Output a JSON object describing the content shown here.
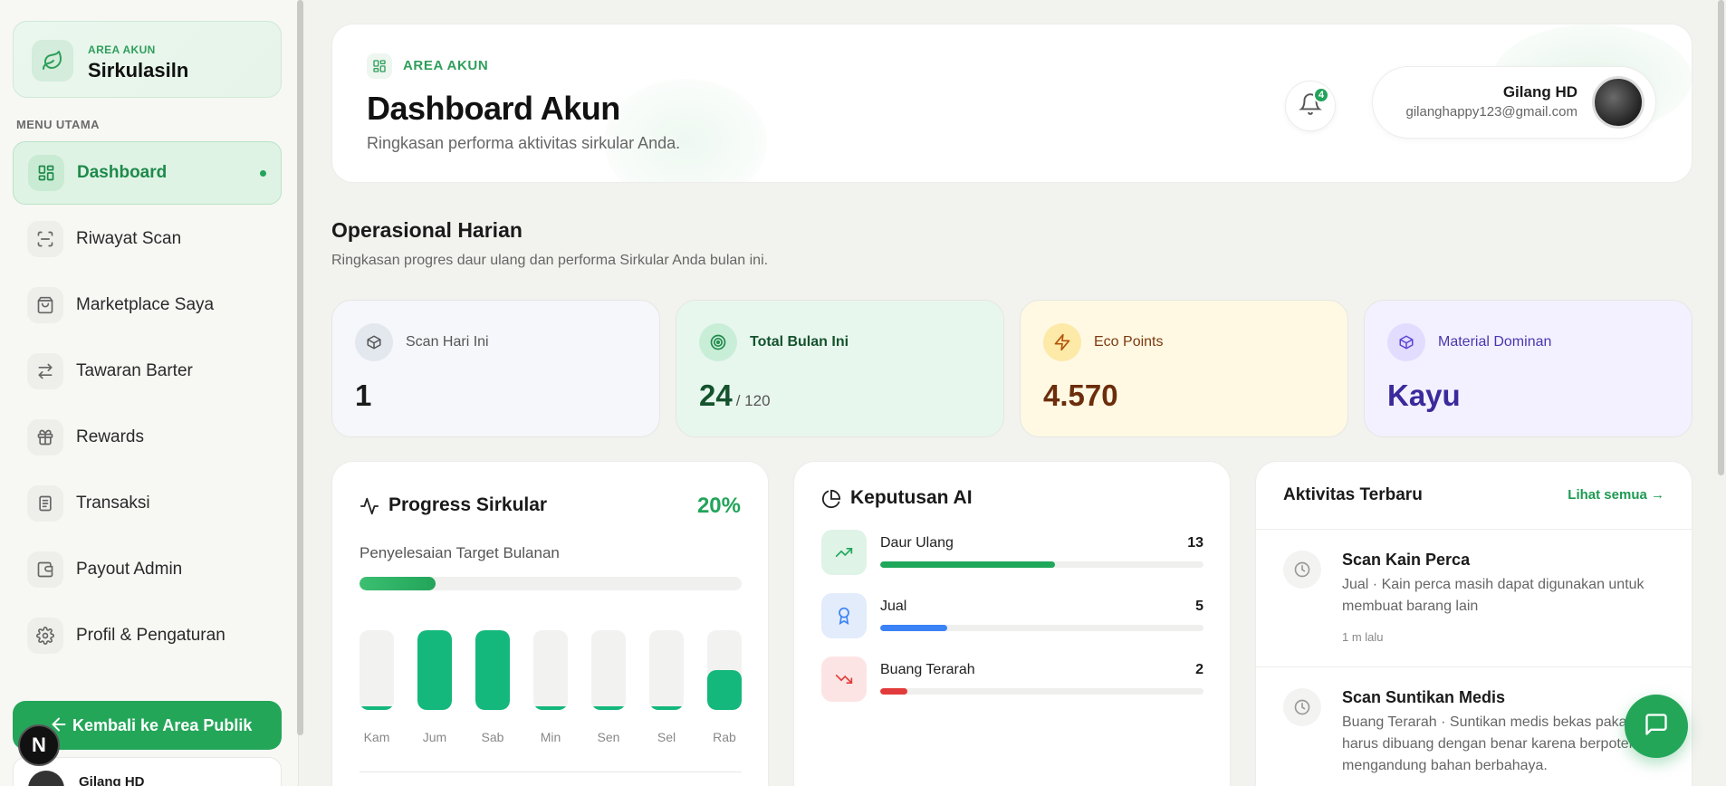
{
  "brand": {
    "small": "AREA AKUN",
    "title": "Sirkulasiln"
  },
  "sidebar": {
    "menu_title": "MENU UTAMA",
    "items": [
      {
        "label": "Dashboard",
        "icon": "dashboard-icon",
        "active": true
      },
      {
        "label": "Riwayat Scan",
        "icon": "scan-icon"
      },
      {
        "label": "Marketplace Saya",
        "icon": "shopping-bag-icon"
      },
      {
        "label": "Tawaran Barter",
        "icon": "swap-icon"
      },
      {
        "label": "Rewards",
        "icon": "gift-icon"
      },
      {
        "label": "Transaksi",
        "icon": "receipt-icon"
      },
      {
        "label": "Payout Admin",
        "icon": "wallet-icon"
      },
      {
        "label": "Profil & Pengaturan",
        "icon": "gear-icon"
      }
    ],
    "back_button": "Kembali ke Area Publik",
    "user_name": "Gilang HD",
    "n_badge": "N"
  },
  "header": {
    "small": "AREA AKUN",
    "title": "Dashboard Akun",
    "subtitle": "Ringkasan performa aktivitas sirkular Anda.",
    "notif_count": "4",
    "user_name": "Gilang HD",
    "user_email": "gilanghappy123@gmail.com"
  },
  "section": {
    "title": "Operasional Harian",
    "subtitle": "Ringkasan progres daur ulang dan performa Sirkular Anda bulan ini."
  },
  "stats": [
    {
      "label": "Scan Hari Ini",
      "value": "1",
      "unit": "",
      "icon": "box-icon",
      "bg": "#f5f7fb",
      "iconbg": "#e3e8ef",
      "valuecolor": "#1a1a1a",
      "labelcolor": "#555555"
    },
    {
      "label": "Total Bulan Ini",
      "value": "24",
      "unit": "/ 120",
      "icon": "target-icon",
      "bg": "#e8f7ee",
      "iconbg": "#c9eed8",
      "valuecolor": "#14532d",
      "labelcolor": "#14532d"
    },
    {
      "label": "Eco Points",
      "value": "4.570",
      "unit": "",
      "icon": "lightning-icon",
      "bg": "#fff9e3",
      "iconbg": "#fde9a8",
      "valuecolor": "#6b2d0c",
      "labelcolor": "#7c3a10"
    },
    {
      "label": "Material Dominan",
      "value": "Kayu",
      "unit": "",
      "icon": "cube-icon",
      "bg": "#f3f1ff",
      "iconbg": "#e2dcff",
      "valuecolor": "#3b2a9c",
      "labelcolor": "#4a36b0"
    }
  ],
  "progress": {
    "title": "Progress Sirkular",
    "percent": "20%",
    "percent_value": 0.2,
    "subtitle": "Penyelesaian Target Bulanan",
    "days": [
      {
        "label": "Kam",
        "value": 0.05
      },
      {
        "label": "Jum",
        "value": 1.0
      },
      {
        "label": "Sab",
        "value": 1.0
      },
      {
        "label": "Min",
        "value": 0.05
      },
      {
        "label": "Sen",
        "value": 0.05
      },
      {
        "label": "Sel",
        "value": 0.05
      },
      {
        "label": "Rab",
        "value": 0.5
      }
    ]
  },
  "ai": {
    "title": "Keputusan AI",
    "items": [
      {
        "label": "Daur Ulang",
        "count": "13",
        "value": 13,
        "icon": "trend-up-icon",
        "bg": "#dff3e7",
        "fill": "#1fa75a"
      },
      {
        "label": "Jual",
        "count": "5",
        "value": 5,
        "icon": "award-icon",
        "bg": "#e2ecfb",
        "fill": "#3b82f6"
      },
      {
        "label": "Buang Terarah",
        "count": "2",
        "value": 2,
        "icon": "trend-down-icon",
        "bg": "#fde4e4",
        "fill": "#e23b3b"
      }
    ],
    "max": 24
  },
  "activity": {
    "title": "Aktivitas Terbaru",
    "more": "Lihat semua →",
    "items": [
      {
        "name": "Scan Kain Perca",
        "desc": "Jual · Kain perca masih dapat digunakan untuk membuat barang lain",
        "time": "1 m lalu"
      },
      {
        "name": "Scan Suntikan Medis",
        "desc": "Buang Terarah · Suntikan medis bekas pakai harus dibuang dengan benar karena berpotensi mengandung bahan berbahaya.",
        "time": ""
      }
    ]
  }
}
